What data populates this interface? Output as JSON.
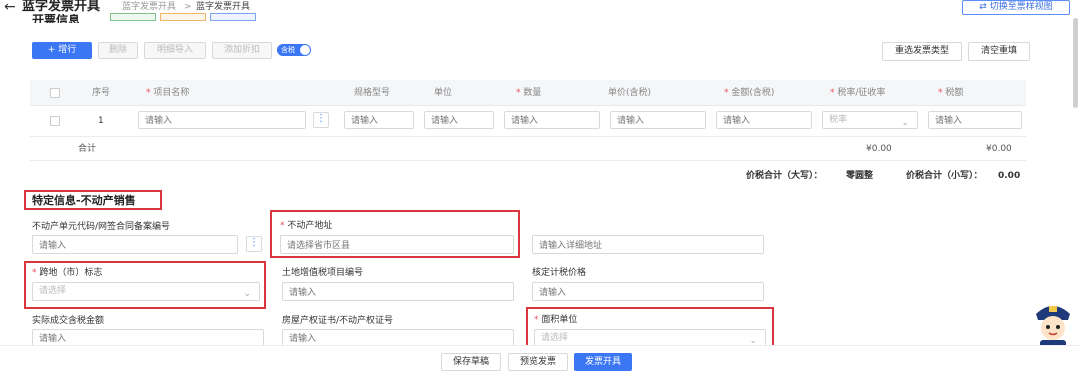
{
  "header": {
    "back_symbol": "←",
    "title": "蓝字发票开具",
    "breadcrumb": [
      "蓝字发票开具",
      ">",
      "蓝字发票开具"
    ],
    "switch_view": "⇄ 切换至票样视图"
  },
  "invoice_section": {
    "title": "开票信息"
  },
  "toolbar": {
    "add": "+ 增行",
    "delete": "删除",
    "import_detail": "明细导入",
    "add_discount": "添加折扣",
    "tax_included": "含税",
    "reselect_type": "重选发票类型",
    "clear_refill": "清空重填"
  },
  "table": {
    "headers": [
      "序号",
      "项目名称",
      "规格型号",
      "单位",
      "数量",
      "单价(含税)",
      "金额(含税)",
      "税率/征收率",
      "税额"
    ],
    "row": {
      "index": "1",
      "name_placeholder": "请输入",
      "spec": "请输入",
      "unit": "请输入",
      "qty": "请输入",
      "price": "请输入",
      "amount": "请输入",
      "tax_rate": "税率",
      "tax": "请输入"
    },
    "total_label": "合计",
    "total_amount": "¥0.00",
    "total_tax": "¥0.00",
    "sum_upper_label": "价税合计（大写）：",
    "sum_upper_value": "零圆整",
    "sum_lower_label": "价税合计（小写）：",
    "sum_lower_value": "0.00"
  },
  "special": {
    "title": "特定信息-不动产销售",
    "fields": {
      "unit_code_label": "不动产单元代码/网签合同备案编号",
      "unit_code_placeholder": "请输入",
      "address_label": "不动产地址",
      "address_region_placeholder": "请选择省市区县",
      "address_detail_placeholder": "请输入详细地址",
      "cross_label": "跨地（市）标志",
      "cross_placeholder": "请选择",
      "land_vat_label": "土地增值税项目编号",
      "land_vat_placeholder": "请输入",
      "verified_price_label": "核定计税价格",
      "verified_price_placeholder": "请输入",
      "actual_amount_label": "实际成交含税金额",
      "actual_amount_placeholder": "请输入",
      "cert_label": "房屋产权证书/不动产权证号",
      "cert_placeholder": "请输入",
      "area_unit_label": "面积单位",
      "area_unit_placeholder": "请选择"
    }
  },
  "footer": {
    "save_draft": "保存草稿",
    "preview": "预览发票",
    "issue": "发票开具"
  },
  "colors": {
    "primary": "#3b77f4",
    "highlight_box": "#d9363e",
    "required": "#e34d59"
  }
}
